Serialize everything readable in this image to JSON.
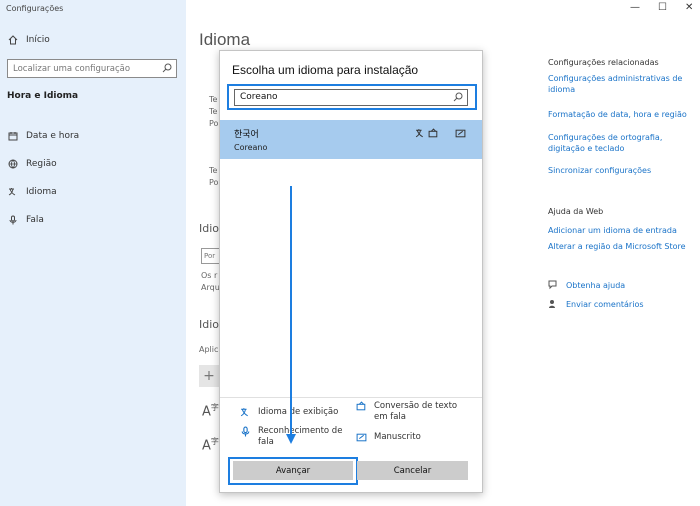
{
  "app": {
    "title": "Configurações"
  },
  "sidebar": {
    "home_label": "Início",
    "search_placeholder": "Localizar uma configuração",
    "section_title": "Hora e Idioma",
    "items": [
      {
        "label": "Data e hora",
        "icon": "calendar-icon"
      },
      {
        "label": "Região",
        "icon": "globe-icon"
      },
      {
        "label": "Idioma",
        "icon": "language-icon"
      },
      {
        "label": "Fala",
        "icon": "microphone-icon"
      }
    ]
  },
  "main": {
    "title": "Idioma",
    "fragments": {
      "t1": "Te",
      "t2": "Te",
      "t3": "Po",
      "t4": "Te",
      "t5": "Po",
      "h1": "Idio",
      "input": "Por",
      "p1": "Os r",
      "p2": "Arqu",
      "h2": "Idio",
      "p3": "Aplic",
      "plus": "+"
    }
  },
  "related": {
    "title": "Configurações relacionadas",
    "links": [
      "Configurações administrativas de idioma",
      "Formatação de data, hora e região",
      "Configurações de ortografia, digitação e teclado",
      "Sincronizar configurações"
    ]
  },
  "web_help": {
    "title": "Ajuda da Web",
    "links": [
      "Adicionar um idioma de entrada",
      "Alterar a região da Microsoft Store"
    ]
  },
  "support": {
    "get_help": "Obtenha ajuda",
    "feedback": "Enviar comentários"
  },
  "dialog": {
    "title": "Escolha um idioma para instalação",
    "search_value": "Coreano",
    "result": {
      "native": "한국어",
      "name": "Coreano"
    },
    "features": {
      "display": "Idioma de exibição",
      "tts": "Conversão de texto em fala",
      "speech": "Reconhecimento de fala",
      "handwriting": "Manuscrito"
    },
    "next_label": "Avançar",
    "cancel_label": "Cancelar"
  },
  "colors": {
    "sidebar_bg": "#e6f0fb",
    "accent": "#1d7ee0",
    "selected_bg": "#a6cbee",
    "link": "#1a73c8"
  }
}
